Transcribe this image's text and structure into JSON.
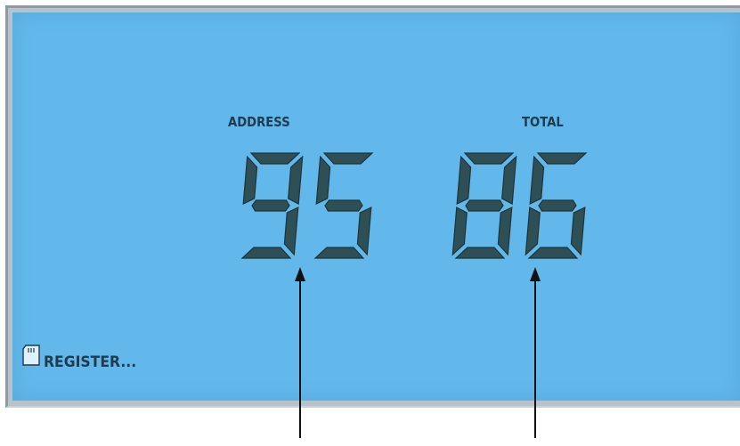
{
  "display": {
    "address_label": "ADDRESS",
    "total_label": "TOTAL",
    "address_value": "95",
    "total_value": "86",
    "register_label": "REGISTER...",
    "register_icon": "memory-card-icon"
  },
  "colors": {
    "lcd_background": "#63b8eb",
    "segment": "#2d4f55",
    "label_text": "#1f3b4e",
    "frame": "#b7c3cb"
  }
}
